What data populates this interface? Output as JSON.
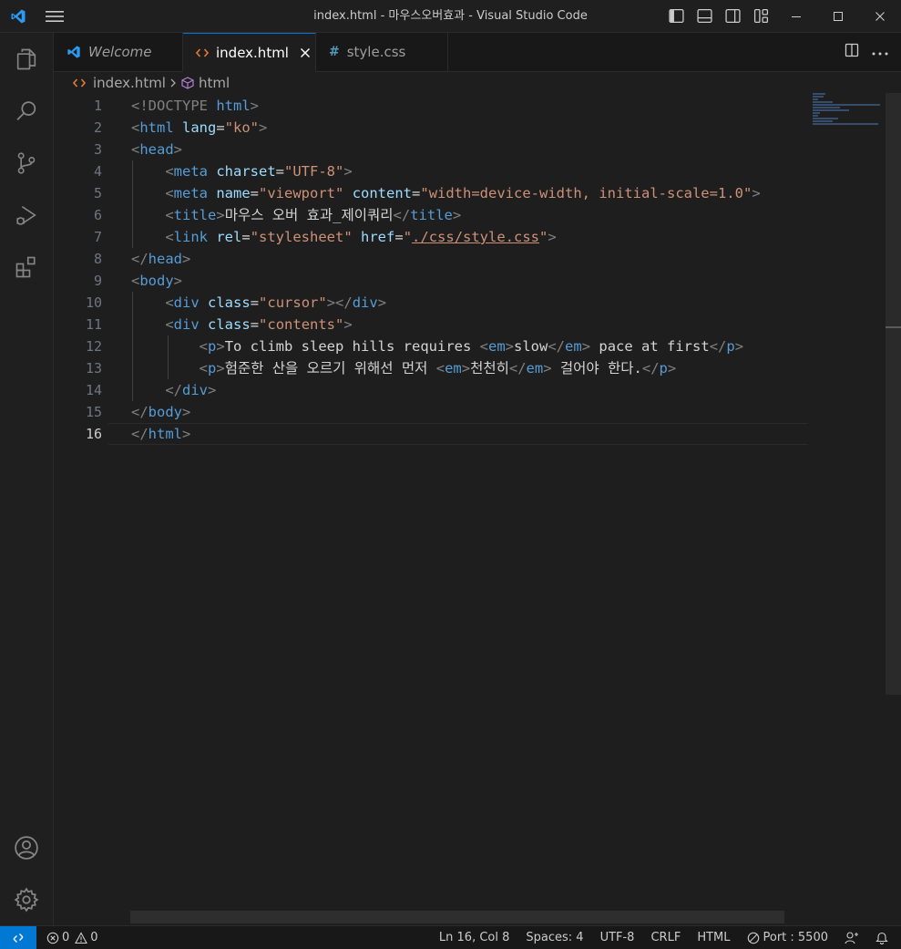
{
  "window": {
    "title": "index.html - 마우스오버효과 - Visual Studio Code"
  },
  "tabs": [
    {
      "label": "Welcome",
      "icon": "vscode-logo-icon",
      "active": false
    },
    {
      "label": "index.html",
      "icon": "html-file-icon",
      "active": true
    },
    {
      "label": "style.css",
      "icon": "css-file-icon",
      "active": false
    }
  ],
  "breadcrumb": {
    "file": "index.html",
    "symbol": "html"
  },
  "editor": {
    "line_numbers": [
      "1",
      "2",
      "3",
      "4",
      "5",
      "6",
      "7",
      "8",
      "9",
      "10",
      "11",
      "12",
      "13",
      "14",
      "15",
      "16"
    ],
    "current_line": 16,
    "tokens": {
      "doctype": "<!DOCTYPE",
      "html": "html",
      "head": "head",
      "meta": "meta",
      "title": "title",
      "link": "link",
      "body": "body",
      "div": "div",
      "p": "p",
      "em": "em",
      "lang": "lang",
      "charset": "charset",
      "name": "name",
      "content": "content",
      "rel": "rel",
      "href": "href",
      "class": "class",
      "v_ko": "\"ko\"",
      "v_utf8": "\"UTF-8\"",
      "v_viewport": "\"viewport\"",
      "v_width": "\"width=device-width, initial-scale=1.0\"",
      "v_stylesheet": "\"stylesheet\"",
      "v_href": "./css/style.css",
      "v_cursor": "\"cursor\"",
      "v_contents": "\"contents\"",
      "title_text": "마우스 오버 효과_제이쿼리",
      "p1_a": "To climb sleep hills requires ",
      "p1_em": "slow",
      "p1_b": " pace at first",
      "p2_a": "험준한 산을 오르기 위해선 먼저 ",
      "p2_em": "천천히",
      "p2_b": " 걸어야 한다."
    }
  },
  "statusbar": {
    "errors": "0",
    "warnings": "0",
    "position": "Ln 16, Col 8",
    "spaces": "Spaces: 4",
    "encoding": "UTF-8",
    "eol": "CRLF",
    "language": "HTML",
    "port": "Port : 5500"
  },
  "colors": {
    "accent": "#0078d4",
    "tag": "#569cd6",
    "attribute": "#9cdcfe",
    "string": "#ce9178"
  }
}
